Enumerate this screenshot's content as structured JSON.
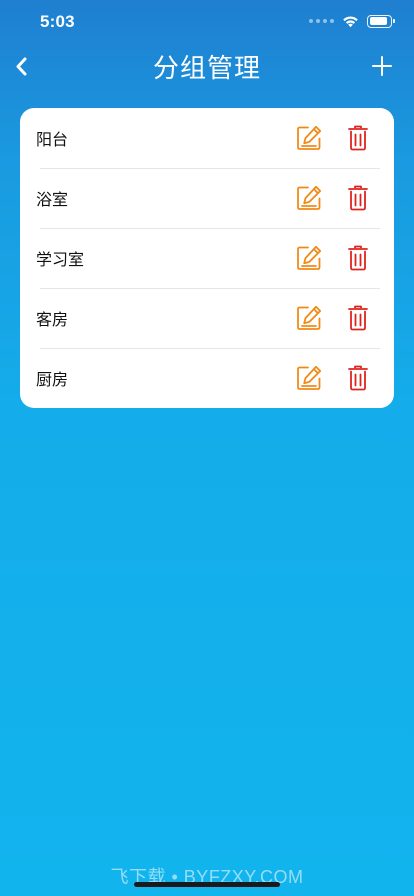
{
  "status_bar": {
    "time": "5:03",
    "battery_level": 0.9
  },
  "nav": {
    "title": "分组管理",
    "back_icon": "chevron-left-icon",
    "add_icon": "plus-icon"
  },
  "colors": {
    "edit": "#f08a17",
    "delete": "#e0231f",
    "background_top": "#1f7fd0",
    "background_bottom": "#12b4ee"
  },
  "groups": [
    {
      "name": "阳台"
    },
    {
      "name": "浴室"
    },
    {
      "name": "学习室"
    },
    {
      "name": "客房"
    },
    {
      "name": "厨房"
    }
  ],
  "watermark": "飞下载 • BYFZXY.COM"
}
